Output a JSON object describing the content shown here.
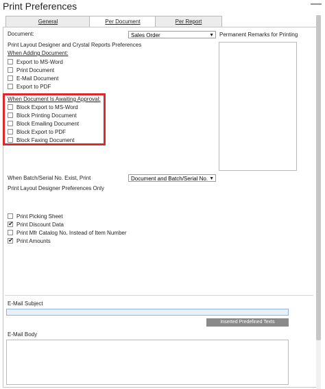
{
  "window": {
    "title": "Print Preferences",
    "close_symbol": "—"
  },
  "tabs": [
    {
      "label": "General",
      "active": false
    },
    {
      "label": "Per Document",
      "active": true
    },
    {
      "label": "Per Report",
      "active": false
    }
  ],
  "document": {
    "label": "Document:",
    "value": "Sales Order"
  },
  "remarks_label": "Permanent Remarks for Printing",
  "layout_prefs_label": "Print Layout Designer and Crystal Reports Preferences",
  "when_adding": {
    "header": "When Adding Document:",
    "items": [
      {
        "label": "Export to MS-Word",
        "checked": false
      },
      {
        "label": "Print Document",
        "checked": false
      },
      {
        "label": "E-Mail Document",
        "checked": false
      },
      {
        "label": "Export to PDF",
        "checked": false
      }
    ]
  },
  "when_awaiting": {
    "header": "When Document Is Awaiting Approval:",
    "items": [
      {
        "label": "Block Export to MS-Word",
        "checked": false
      },
      {
        "label": "Block Printing Document",
        "checked": false
      },
      {
        "label": "Block Emailing Document",
        "checked": false
      },
      {
        "label": "Block Export to PDF",
        "checked": false
      },
      {
        "label": "Block Faxing Document",
        "checked": false
      }
    ]
  },
  "batch": {
    "label": "When Batch/Serial No. Exist, Print",
    "value": "Document and Batch/Serial No."
  },
  "pld_only_label": "Print Layout Designer Preferences Only",
  "pld_options": [
    {
      "label": "Print Picking Sheet",
      "checked": false
    },
    {
      "label": "Print Discount Data",
      "checked": true
    },
    {
      "label": "Print Mfr Catalog No. Instead of Item Number",
      "checked": false
    },
    {
      "label": "Print Amounts",
      "checked": true
    }
  ],
  "email": {
    "subject_label": "E-Mail Subject",
    "subject_value": "",
    "inserted_button": "Inserted Predefined Texts",
    "body_label": "E-Mail Body"
  },
  "colors": {
    "highlight": "#e0282c",
    "input_bg": "#e8f1fb",
    "button_bg": "#8a8a8a"
  },
  "icons": {
    "check": "✔",
    "dropdown_arrow": "▼"
  }
}
